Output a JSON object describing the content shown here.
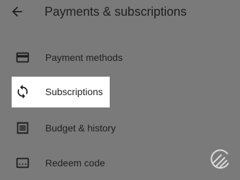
{
  "header": {
    "title": "Payments & subscriptions",
    "back_icon": "arrow-back-icon"
  },
  "menu": {
    "items": [
      {
        "label": "Payment methods",
        "icon": "credit-card-icon"
      },
      {
        "label": "Subscriptions",
        "icon": "sync-icon",
        "highlighted": true
      },
      {
        "label": "Budget & history",
        "icon": "receipt-icon"
      },
      {
        "label": "Redeem code",
        "icon": "gift-card-icon"
      }
    ]
  },
  "watermark": {
    "icon": "site-logo-icon"
  },
  "colors": {
    "overlay": "#7a7a7a",
    "highlight": "#ffffff",
    "text": "#1f1f1f"
  }
}
